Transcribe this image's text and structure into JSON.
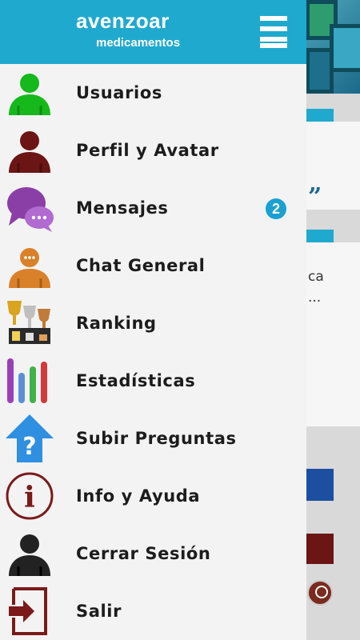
{
  "header": {
    "brand": "avenzoar",
    "subtitle": "medicamentos",
    "menu_icon": "hamburger-menu-icon",
    "color": "#20a9cf"
  },
  "background": {
    "quote_mark": "”",
    "text_line_1": "ca",
    "text_line_2": "..."
  },
  "drawer": {
    "items": [
      {
        "label": "Usuarios",
        "icon": "users-icon",
        "color": "#16b81c"
      },
      {
        "label": "Perfil y Avatar",
        "icon": "profile-icon",
        "color": "#6b1515"
      },
      {
        "label": "Mensajes",
        "icon": "messages-icon",
        "color": "#8a3fa6",
        "badge": "2"
      },
      {
        "label": "Chat General",
        "icon": "chat-general-icon",
        "color": "#d9812a"
      },
      {
        "label": "Ranking",
        "icon": "trophy-icon",
        "color": "#c9a227"
      },
      {
        "label": "Estadísticas",
        "icon": "statistics-icon",
        "color": "#5b8fd6"
      },
      {
        "label": "Subir Preguntas",
        "icon": "upload-question-icon",
        "color": "#2f8fe0"
      },
      {
        "label": "Info y Ayuda",
        "icon": "info-icon",
        "color": "#7b1a1a"
      },
      {
        "label": "Cerrar Sesión",
        "icon": "logout-user-icon",
        "color": "#222222"
      },
      {
        "label": "Salir",
        "icon": "exit-icon",
        "color": "#7b1a1a"
      }
    ],
    "badge_color": "#1aa1d2"
  }
}
